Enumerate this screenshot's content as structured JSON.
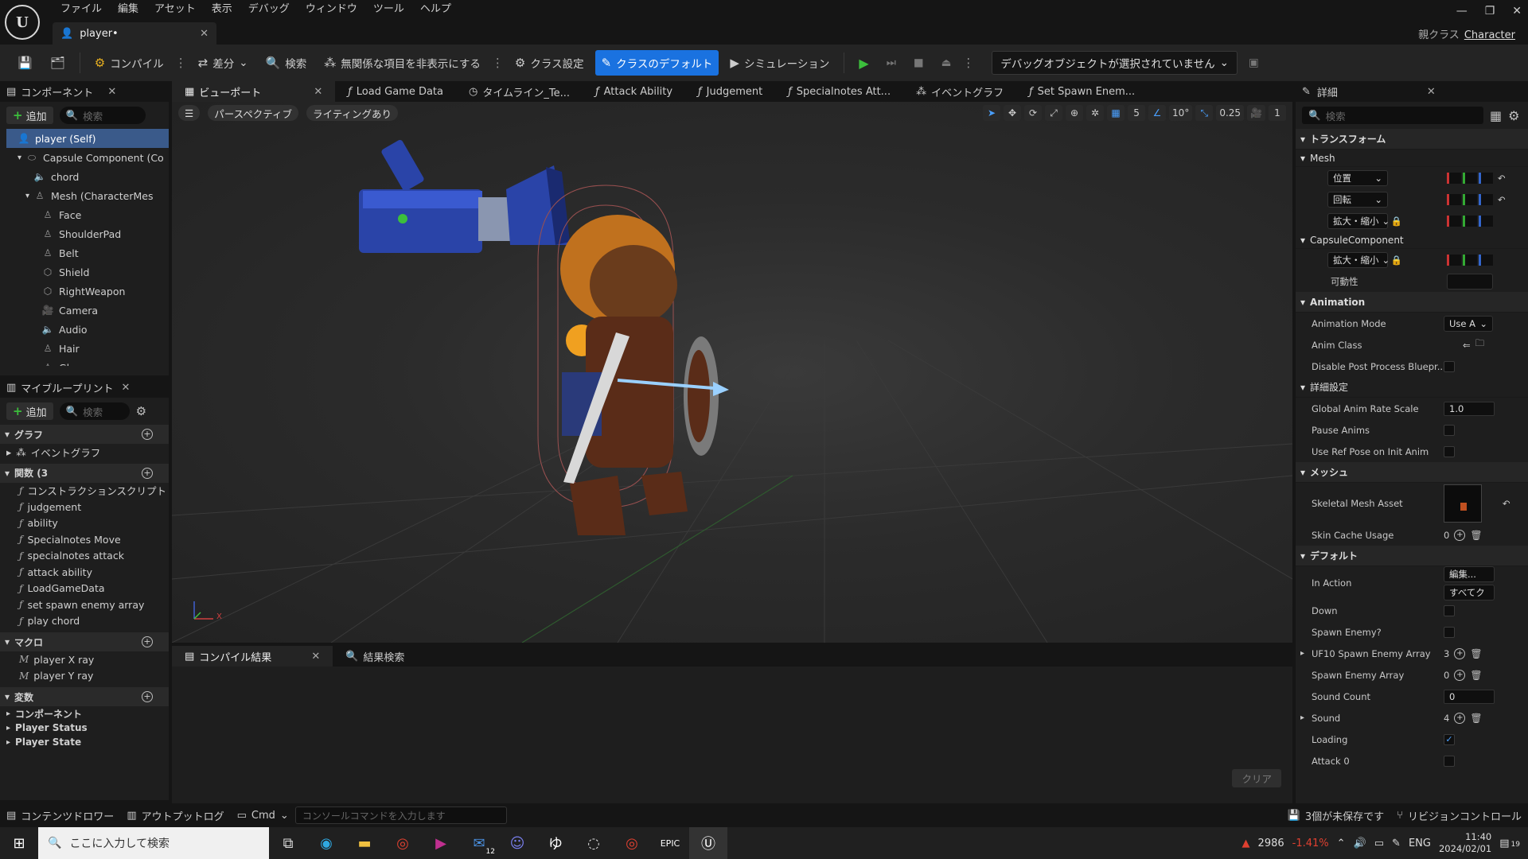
{
  "menu": [
    "ファイル",
    "編集",
    "アセット",
    "表示",
    "デバッグ",
    "ウィンドウ",
    "ツール",
    "ヘルプ"
  ],
  "document_tab": "player•",
  "parent_class": {
    "label": "親クラス",
    "value": "Character"
  },
  "toolbar": {
    "compile": "コンパイル",
    "diff": "差分",
    "find": "検索",
    "hide_unrelated": "無関係な項目を非表示にする",
    "class_settings": "クラス設定",
    "class_defaults": "クラスのデフォルト",
    "simulation": "シミュレーション",
    "debug_object": "デバッグオブジェクトが選択されていません"
  },
  "components": {
    "title": "コンポーネント",
    "add": "追加",
    "search_placeholder": "検索",
    "items": [
      {
        "label": "player (Self)",
        "icon": "person-icon"
      },
      {
        "label": "Capsule Component (Co",
        "icon": "capsule-icon"
      },
      {
        "label": "chord",
        "icon": "speaker-icon"
      },
      {
        "label": "Mesh (CharacterMes",
        "icon": "skeleton-icon"
      },
      {
        "label": "Face",
        "icon": "skeleton-icon"
      },
      {
        "label": "ShoulderPad",
        "icon": "skeleton-icon"
      },
      {
        "label": "Belt",
        "icon": "skeleton-icon"
      },
      {
        "label": "Shield",
        "icon": "mesh-icon"
      },
      {
        "label": "RightWeapon",
        "icon": "mesh-icon"
      },
      {
        "label": "Camera",
        "icon": "camera-icon"
      },
      {
        "label": "Audio",
        "icon": "speaker-icon"
      },
      {
        "label": "Hair",
        "icon": "skeleton-icon"
      },
      {
        "label": "Glove",
        "icon": "skeleton-icon"
      }
    ]
  },
  "my_blueprint": {
    "title": "マイブループリント",
    "add": "追加",
    "search_placeholder": "検索",
    "graph_section": "グラフ",
    "event_graph": "イベントグラフ",
    "functions_section": "関数 (3",
    "functions": [
      "コンストラクションスクリプト",
      "judgement",
      "ability",
      "Specialnotes Move",
      "specialnotes attack",
      "attack ability",
      "LoadGameData",
      "set spawn enemy array",
      "play chord"
    ],
    "macros_section": "マクロ",
    "macros": [
      "player X ray",
      "player Y ray"
    ],
    "variables_section": "変数",
    "variable_categories": [
      "コンポーネント",
      "Player Status",
      "Player State"
    ]
  },
  "viewport_tabs": [
    {
      "label": "ビューポート",
      "icon": "viewport-icon"
    },
    {
      "label": "Load Game Data",
      "icon": "function-icon"
    },
    {
      "label": "タイムライン_Te...",
      "icon": "clock-icon"
    },
    {
      "label": "Attack Ability",
      "icon": "function-icon"
    },
    {
      "label": "Judgement",
      "icon": "function-icon"
    },
    {
      "label": "Specialnotes Att...",
      "icon": "function-icon"
    },
    {
      "label": "イベントグラフ",
      "icon": "graph-icon"
    },
    {
      "label": "Set Spawn Enem...",
      "icon": "function-icon"
    }
  ],
  "viewport": {
    "perspective": "パースペクティブ",
    "lighting": "ライティングあり",
    "grid_snap": "5",
    "rot_snap": "10°",
    "scale_snap": "0.25",
    "camera_speed": "1",
    "axis_x": "X"
  },
  "compile": {
    "tab": "コンパイル結果",
    "find_tab": "結果検索",
    "clear": "クリア"
  },
  "details": {
    "title": "詳細",
    "search_placeholder": "検索",
    "transform": "トランスフォーム",
    "mesh_sub": "Mesh",
    "location": "位置",
    "rotation": "回転",
    "scale": "拡大・縮小",
    "capsule_sub": "CapsuleComponent",
    "capsule_scale": "拡大・縮小",
    "visibility": "可動性",
    "animation": "Animation",
    "anim_mode": {
      "label": "Animation Mode",
      "value": "Use A"
    },
    "anim_class": "Anim Class",
    "disable_pp": "Disable Post Process Bluepr...",
    "advanced": "詳細設定",
    "global_rate": {
      "label": "Global Anim Rate Scale",
      "value": "1.0"
    },
    "pause_anims": "Pause Anims",
    "ref_pose": "Use Ref Pose on Init Anim",
    "mesh_section": "メッシュ",
    "skeletal_mesh": "Skeletal Mesh Asset",
    "skin_cache": {
      "label": "Skin Cache Usage",
      "value": "0"
    },
    "default_section": "デフォルト",
    "in_action": {
      "label": "In Action",
      "edit": "編集...",
      "all": "すべてク"
    },
    "down": "Down",
    "spawn_enemy_q": "Spawn Enemy?",
    "uf10": {
      "label": "UF10 Spawn Enemy Array",
      "value": "3"
    },
    "spawn_array": {
      "label": "Spawn Enemy Array",
      "value": "0"
    },
    "sound_count": {
      "label": "Sound Count",
      "value": "0"
    },
    "sound": {
      "label": "Sound",
      "value": "4"
    },
    "loading": "Loading",
    "attack0": "Attack 0"
  },
  "status": {
    "content_drawer": "コンテンツドロワー",
    "output_log": "アウトプットログ",
    "cmd": "Cmd",
    "console_placeholder": "コンソールコマンドを入力します",
    "unsaved": "3個が未保存です",
    "revision": "リビジョンコントロール"
  },
  "taskbar": {
    "search_placeholder": "ここに入力して検索",
    "stock_value": "2986",
    "stock_change": "-1.41%",
    "lang": "ENG",
    "time": "11:40",
    "date": "2024/02/01",
    "notif": "19",
    "mail_badge": "12"
  }
}
